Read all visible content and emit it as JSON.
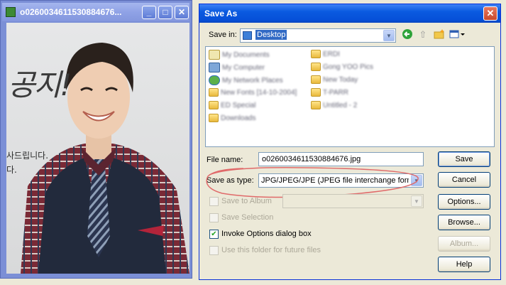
{
  "viewer": {
    "title": "o0260034611530884676...",
    "buttons": {
      "minimize": "_",
      "maximize": "□",
      "close": "✕"
    },
    "image": {
      "big_text": "공지!",
      "small_lines": [
        "사드립니다.",
        "다."
      ]
    }
  },
  "dialog": {
    "title": "Save As",
    "close": "✕",
    "save_in_label": "Save in:",
    "save_in_value": "Desktop",
    "toolbar_icons": [
      "back-icon",
      "up-folder-icon",
      "new-folder-icon",
      "view-menu-icon"
    ],
    "files": [
      {
        "name": "My Documents",
        "icon": "documents-icon"
      },
      {
        "name": "My Computer",
        "icon": "computer-icon"
      },
      {
        "name": "My Network Places",
        "icon": "network-icon"
      },
      {
        "name": "New Fonts [14-10-2004]",
        "icon": "folder-icon"
      },
      {
        "name": "ED Special",
        "icon": "shortcut-icon"
      },
      {
        "name": "Downloads",
        "icon": "shortcut-icon"
      },
      {
        "name": "ERDI",
        "icon": "folder-icon"
      },
      {
        "name": "Gong YOO Pics",
        "icon": "folder-icon"
      },
      {
        "name": "New Today",
        "icon": "folder-icon"
      },
      {
        "name": "T-PARR",
        "icon": "folder-icon"
      },
      {
        "name": "Untitled - 2",
        "icon": "shortcut-icon"
      }
    ],
    "file_name_label": "File name:",
    "file_name_value": "o0260034611530884676.jpg",
    "save_as_type_label": "Save as type:",
    "save_as_type_value": "JPG/JPEG/JPE (JPEG file interchange forma",
    "save_to_album_label": "Save to Album",
    "save_selection_label": "Save Selection",
    "invoke_options_label": "Invoke Options dialog box",
    "use_folder_label": "Use this folder for future files",
    "buttons": {
      "save": "Save",
      "cancel": "Cancel",
      "options": "Options...",
      "browse": "Browse...",
      "album": "Album...",
      "help": "Help"
    },
    "colors": {
      "titlebar": "#0a5ae0",
      "annotation": "#e06a6a"
    }
  }
}
